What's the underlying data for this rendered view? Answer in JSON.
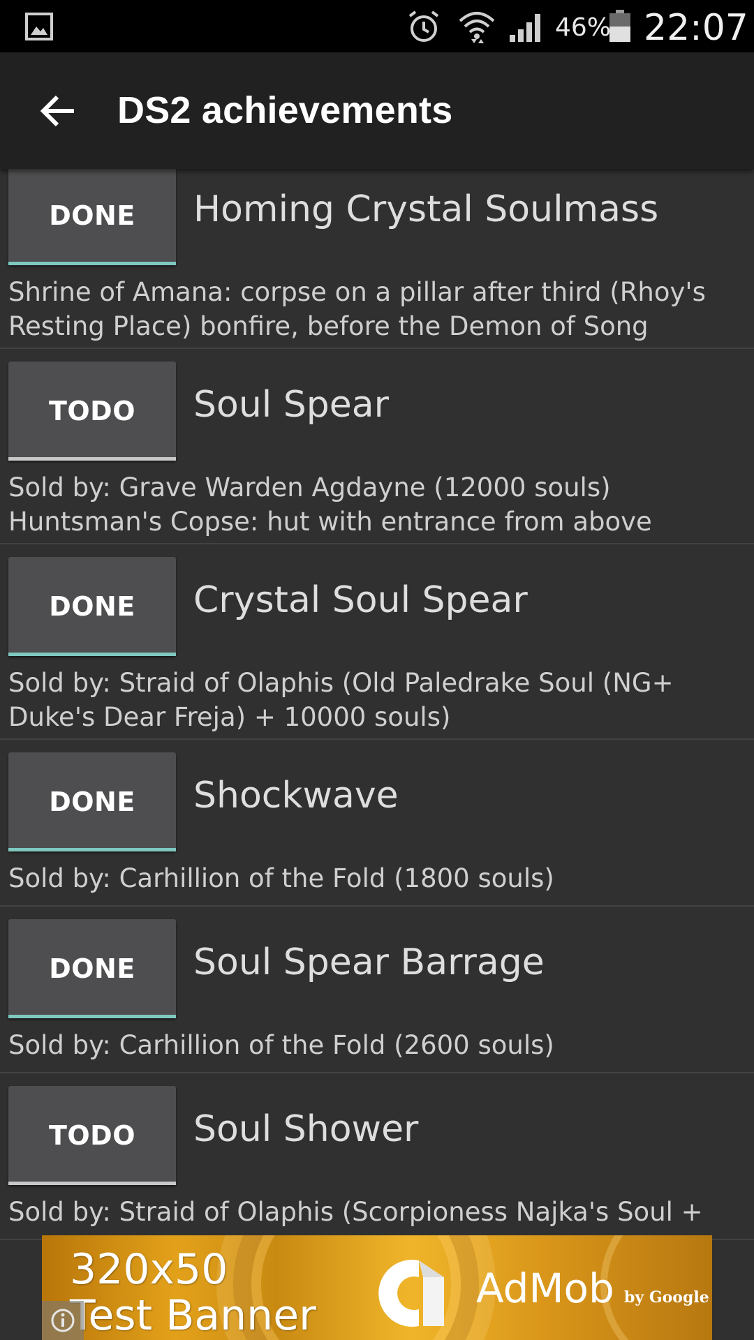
{
  "status_bar": {
    "battery_percent": "46%",
    "clock": "22:07",
    "icons": [
      "gallery-icon",
      "alarm-icon",
      "wifi-icon",
      "signal-icon",
      "battery-icon"
    ]
  },
  "app_bar": {
    "back_icon": "back-arrow-icon",
    "title": "DS2 achievements"
  },
  "colors": {
    "background": "#303030",
    "app_bar": "#212121",
    "button": "#4e4e50",
    "done_accent": "#7ec8c0",
    "todo_accent": "#c8c8c8"
  },
  "items": [
    {
      "status": "DONE",
      "name": "Homing Crystal Soulmass",
      "description": "Shrine of Amana: corpse on a pillar after third (Rhoy's Resting Place) bonfire, before the Demon of Song"
    },
    {
      "status": "TODO",
      "name": "Soul Spear",
      "description": "Sold by: Grave Warden Agdayne (12000 souls) Huntsman's Copse: hut with entrance from above"
    },
    {
      "status": "DONE",
      "name": "Crystal Soul Spear",
      "description": "Sold by: Straid of Olaphis (Old Paledrake Soul (NG+ Duke's Dear Freja) + 10000 souls)"
    },
    {
      "status": "DONE",
      "name": "Shockwave",
      "description": "Sold by: Carhillion of the Fold (1800 souls)"
    },
    {
      "status": "DONE",
      "name": "Soul Spear Barrage",
      "description": "Sold by: Carhillion of the Fold (2600 souls)"
    },
    {
      "status": "TODO",
      "name": "Soul Shower",
      "description": "Sold by: Straid of Olaphis (Scorpioness Najka's Soul +"
    }
  ],
  "ad": {
    "line1": "320x50",
    "line2": "Test Banner",
    "brand": "AdMob",
    "by": "by Google",
    "info_icon": "info-icon"
  }
}
